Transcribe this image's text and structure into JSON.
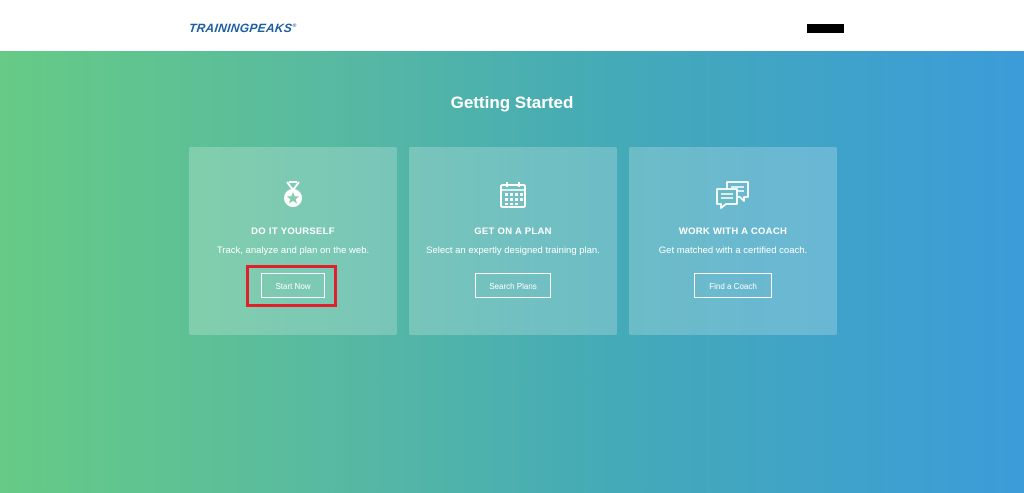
{
  "header": {
    "logo": "TRAININGPEAKS",
    "logo_tm": "®"
  },
  "main": {
    "title": "Getting Started",
    "cards": [
      {
        "icon": "medal-icon",
        "heading": "DO IT YOURSELF",
        "description": "Track, analyze and plan on the web.",
        "button": "Start Now"
      },
      {
        "icon": "calendar-icon",
        "heading": "GET ON A PLAN",
        "description": "Select an expertly designed training plan.",
        "button": "Search Plans"
      },
      {
        "icon": "chat-bubbles-icon",
        "heading": "WORK WITH A COACH",
        "description": "Get matched with a certified coach.",
        "button": "Find a Coach"
      }
    ]
  },
  "colors": {
    "logo": "#1d5fa3",
    "gradient_start": "#66cb85",
    "gradient_end": "#3b9cd9",
    "highlight": "#e0202a"
  }
}
